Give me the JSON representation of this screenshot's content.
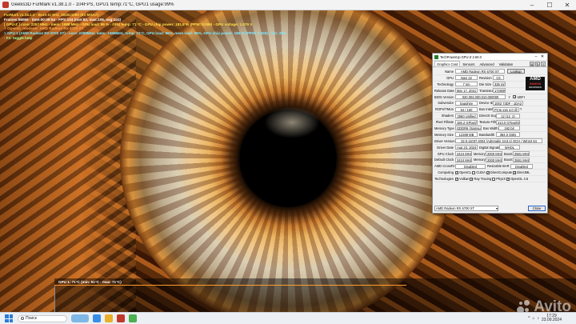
{
  "window": {
    "title": "Geeks3D FurMark v1.38.1.0 - 104FPS, GPU1 temp:71°C, GPU1 usage:99%"
  },
  "osd": {
    "lines": [
      "FurMark v1.38.1.0 - Burn-in test, 1920x1080 (8X MSAA)",
      "Frames:98066 - time:00:09:54 - FPS:104 (min:92, max:108, avg:104)",
      "[ GPU-Z ] core: 2257 MHz - mem: 1988 MHz - GPU load: 99 % - GPU temp: 71 °C - GPU chip power: 181.8 W (PPW: 0.095) - GPU voltage: 1.075 V",
      "> OpenGL renderer: AMD Radeon RX 6700 XT",
      "> GPU 1 (AMD Radeon RX 6700 XT) - core: 2288MHz, mem: 1988MHz, temp: 71°C, GPU load: 99%, mem load: 96%, GPU chip power: 186 W (PPW: 0.559) - fan: 39%",
      "- F1: toggle help"
    ]
  },
  "graph": {
    "label": "GPU 1: 71°C (min: 51°C - max: 71°C)"
  },
  "gpuz": {
    "title": "TechPowerUp GPU-Z 2.60.0",
    "tabs": [
      "Graphics Card",
      "Sensors",
      "Advanced",
      "Validation"
    ],
    "logo": {
      "brand": "AMD",
      "line2": "RADEON",
      "line3": "GRAPHICS"
    },
    "labels": {
      "name": "Name",
      "gpu": "GPU",
      "revision": "Revision",
      "technology": "Technology",
      "die_size": "Die Size",
      "release_date": "Release Date",
      "transistors": "Transistors",
      "bios": "BIOS Version",
      "uefi": "UEFI",
      "subvendor": "Subvendor",
      "device_id": "Device ID",
      "rops": "ROPs/TMUs",
      "bus_interface": "Bus Interface",
      "shaders": "Shaders",
      "directx": "DirectX Support",
      "pixel_fillrate": "Pixel Fillrate",
      "texture_fillrate": "Texture Fillrate",
      "memory_type": "Memory Type",
      "bus_width": "Bus Width",
      "memory_size": "Memory Size",
      "bandwidth": "Bandwidth",
      "driver_version": "Driver Version",
      "driver_date": "Driver Date",
      "digital_signature": "Digital Signature",
      "gpu_clock": "GPU Clock",
      "default_clock": "Default Clock",
      "memory": "Memory",
      "boost": "Boost",
      "crossfire": "AMD CrossFire",
      "resizable_bar": "Resizable BAR",
      "computing": "Computing",
      "technologies": "Technologies"
    },
    "values": {
      "name": "AMD Radeon RX 6700 XT",
      "lookup": "Lookup",
      "gpu": "Navi 22",
      "revision": "C5",
      "technology": "7 nm",
      "die_size": "336 mm²",
      "release_date": "Mar 17, 2021",
      "transistors": "17200M",
      "bios": "020.002.000.010.000000",
      "subvendor": "Sapphire",
      "device_id": "1002 73DF - 1DA2 E445",
      "rops": "64 / 160",
      "bus_interface": "PCIe x16 4.0 @ x16 3.0",
      "shaders": "2560 Unified",
      "directx": "12 (12_2)",
      "pixel_fillrate": "165.2 GPixel/s",
      "texture_fillrate": "413.0 GTexel/s",
      "memory_type": "GDDR6 (Samsung)",
      "bus_width": "192 bit",
      "memory_size": "12288 MB",
      "bandwidth": "384.0 GB/s",
      "driver_version": "32.0.11037.4004 (Adrenalin 24.8.1) DCH / Win10 64",
      "driver_date": "Aug 23, 2024",
      "digital_signature": "WHQL",
      "gpu_clock": "2424 MHz",
      "gpu_memory": "2000 MHz",
      "gpu_boost": "2581 MHz",
      "default_clock": "2424 MHz",
      "default_memory": "2000 MHz",
      "default_boost": "2581 MHz",
      "crossfire": "Disabled",
      "resizable_bar": "Disabled",
      "computing": [
        "OpenCL",
        "CUDA",
        "DirectCompute",
        "DirectML"
      ],
      "technologies": [
        "Vulkan",
        "Ray Tracing",
        "PhysX",
        "OpenGL 4.6"
      ]
    },
    "select_value": "AMD Radeon RX 6700 XT",
    "close_label": "Close"
  },
  "taskbar": {
    "search_placeholder": "Поиск",
    "time": "17:29",
    "date": "23.09.2024"
  },
  "watermark": "Avito"
}
